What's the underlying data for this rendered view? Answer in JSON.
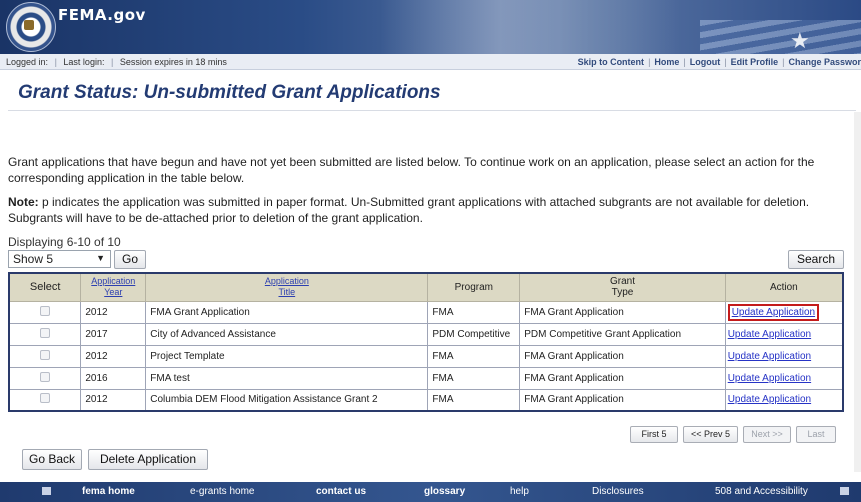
{
  "header": {
    "site_title": "FEMA.gov",
    "logo_icon": "dhs-seal-icon"
  },
  "statusbar": {
    "logged_in": "Logged in:",
    "last_login": "Last login:",
    "session": "Session expires in 18 mins",
    "links": [
      "Skip to Content",
      "Home",
      "Logout",
      "Edit Profile",
      "Change Passwor"
    ]
  },
  "page": {
    "title": "Grant Status: Un-submitted Grant Applications",
    "intro": "Grant applications that have begun and have not yet been submitted are listed below. To continue work on an application, please select an action for the corresponding application in the table below.",
    "note_label": "Note:",
    "note_text": " p indicates the application was submitted in paper format. Un-Submitted grant applications with attached subgrants are not available for deletion. Subgrants will have to be de-attached prior to deletion of the grant application."
  },
  "controls": {
    "displaying": "Displaying 6-10 of 10",
    "page_size_value": "Show 5",
    "go_label": "Go",
    "search_label": "Search"
  },
  "table": {
    "headers": {
      "select": "Select",
      "app_year_1": "Application",
      "app_year_2": "Year",
      "app_title_1": "Application",
      "app_title_2": "Title",
      "program": "Program",
      "grant_type_1": "Grant",
      "grant_type_2": "Type",
      "action": "Action"
    },
    "rows": [
      {
        "year": "2012",
        "title": "FMA Grant Application",
        "program": "FMA",
        "type": "FMA Grant Application",
        "action": "Update Application",
        "highlighted": true
      },
      {
        "year": "2017",
        "title": "City of Advanced Assistance",
        "program": "PDM Competitive",
        "type": "PDM Competitive Grant Application",
        "action": "Update Application",
        "highlighted": false
      },
      {
        "year": "2012",
        "title": "Project Template",
        "program": "FMA",
        "type": "FMA Grant Application",
        "action": "Update Application",
        "highlighted": false
      },
      {
        "year": "2016",
        "title": "FMA test",
        "program": "FMA",
        "type": "FMA Grant Application",
        "action": "Update Application",
        "highlighted": false
      },
      {
        "year": "2012",
        "title": "Columbia DEM Flood Mitigation Assistance Grant 2",
        "program": "FMA",
        "type": "FMA Grant Application",
        "action": "Update Application",
        "highlighted": false
      }
    ]
  },
  "pager": {
    "first": "First 5",
    "prev": "<< Prev 5",
    "next": "Next >>",
    "last": "Last"
  },
  "actions": {
    "go_back": "Go Back",
    "delete": "Delete Application"
  },
  "footer": {
    "links": [
      "fema home",
      "e-grants home",
      "contact us",
      "glossary",
      "help",
      "Disclosures",
      "508 and Accessibility"
    ]
  },
  "colors": {
    "title": "#233b73",
    "header_band": "#dcd9c4",
    "link": "#2633c6",
    "highlight": "#c41b1b"
  }
}
